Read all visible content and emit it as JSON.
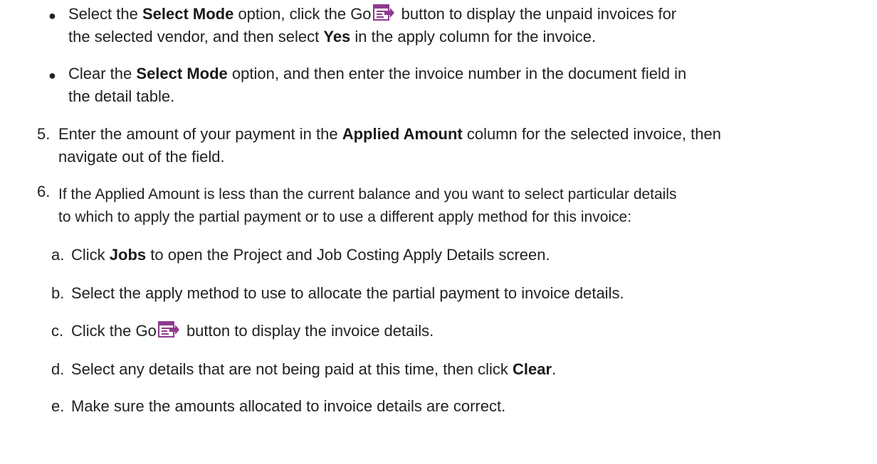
{
  "bullets": [
    {
      "l1_pre": "Select the ",
      "l1_bold": "Select Mode",
      "l1_mid": " option, click the Go",
      "l1_post": " button to display the unpaid invoices for",
      "l2_pre": "the selected vendor, and then select ",
      "l2_bold": "Yes",
      "l2_post": " in the apply column for the invoice."
    },
    {
      "l1_pre": "Clear the ",
      "l1_bold": "Select Mode",
      "l1_post": " option, and then enter the invoice number in the document field in",
      "l2": "the detail table."
    }
  ],
  "steps": [
    {
      "num": "5.",
      "l1_pre": "Enter the amount of your payment in the ",
      "l1_bold": "Applied Amount",
      "l1_post": " column for the selected invoice, then",
      "l2": "navigate out of the field."
    },
    {
      "num": "6.",
      "l1": "If the Applied Amount is less than the current balance and you want to select particular details",
      "l2": "to which to apply the partial payment or to use a different apply method for this invoice:"
    }
  ],
  "substeps": [
    {
      "letter": "a.",
      "pre": "Click ",
      "bold": "Jobs",
      "post": " to open the Project and Job Costing Apply Details screen."
    },
    {
      "letter": "b.",
      "text": "Select the apply method to use to allocate the partial payment to invoice details."
    },
    {
      "letter": "c.",
      "pre": "Click the Go",
      "post": " button to display the invoice details."
    },
    {
      "letter": "d.",
      "pre": "Select any details that are not being paid at this time, then click ",
      "bold": "Clear",
      "post": "."
    },
    {
      "letter": "e.",
      "text": "Make sure the amounts allocated to invoice details are correct."
    }
  ],
  "icons": {
    "go_button": "go-icon",
    "accent": "#8e3a8e"
  }
}
